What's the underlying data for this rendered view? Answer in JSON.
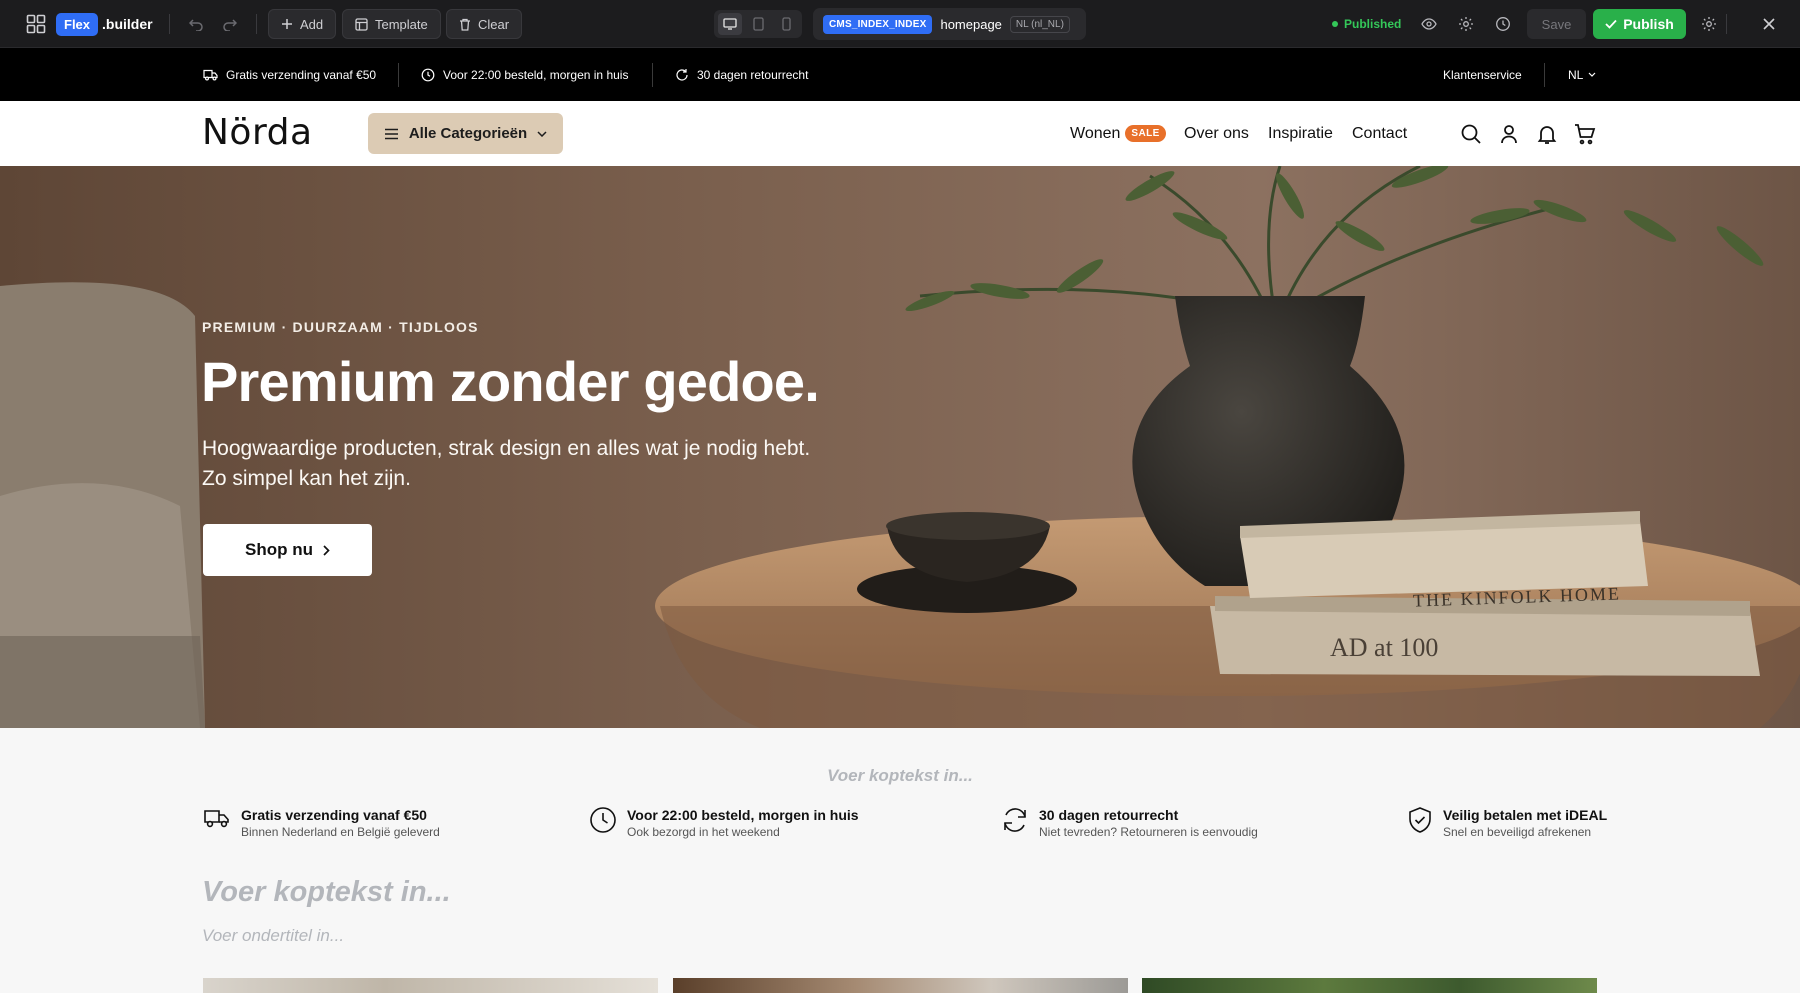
{
  "builder": {
    "brand_badge": "Flex",
    "brand_word": ".builder",
    "add_label": "Add",
    "template_label": "Template",
    "clear_label": "Clear",
    "page_code": "CMS_INDEX_INDEX",
    "page_name": "homepage",
    "locale": "NL (nl_NL)",
    "status": "Published",
    "save_label": "Save",
    "publish_label": "Publish",
    "active_device": "desktop"
  },
  "announcement": {
    "items": [
      {
        "icon": "truck-icon",
        "text": "Gratis verzending vanaf €50"
      },
      {
        "icon": "clock-icon",
        "text": "Voor 22:00 besteld, morgen in huis"
      },
      {
        "icon": "refresh-icon",
        "text": "30 dagen retourrecht"
      }
    ],
    "service_label": "Klantenservice",
    "language": "NL"
  },
  "nav": {
    "logo": "Nörda",
    "categories_label": "Alle Categorieën",
    "links": [
      {
        "label": "Wonen",
        "badge": "SALE"
      },
      {
        "label": "Over ons"
      },
      {
        "label": "Inspiratie"
      },
      {
        "label": "Contact"
      }
    ],
    "icons": [
      "search-icon",
      "user-icon",
      "bell-icon",
      "cart-icon"
    ]
  },
  "hero": {
    "eyebrow": "PREMIUM · DUURZAAM · TIJDLOOS",
    "title": "Premium zonder gedoe.",
    "subtitle_line1": "Hoogwaardige producten, strak design en alles wat je nodig hebt.",
    "subtitle_line2": "Zo simpel kan het zijn.",
    "cta_label": "Shop nu",
    "book_top": "THE KINFOLK HOME",
    "book_bottom": "AD at 100"
  },
  "usp": {
    "heading_placeholder": "Voer koptekst in...",
    "items": [
      {
        "icon": "truck-icon",
        "title": "Gratis verzending vanaf €50",
        "subtitle": "Binnen Nederland en België geleverd"
      },
      {
        "icon": "clock-icon",
        "title": "Voor 22:00 besteld, morgen in huis",
        "subtitle": "Ook bezorgd in het weekend"
      },
      {
        "icon": "refresh-icon",
        "title": "30 dagen retourrecht",
        "subtitle": "Niet tevreden? Retourneren is eenvoudig"
      },
      {
        "icon": "shield-check-icon",
        "title": "Veilig betalen met iDEAL",
        "subtitle": "Snel en beveiligd afrekenen"
      }
    ]
  },
  "section": {
    "title_placeholder": "Voer koptekst in...",
    "subtitle_placeholder": "Voer ondertitel in..."
  },
  "colors": {
    "builder_bg": "#1c1c1e",
    "accent_blue": "#2f6df5",
    "publish_green": "#29b04a",
    "category_button": "#dccbb4",
    "sale_badge": "#e8702a"
  }
}
